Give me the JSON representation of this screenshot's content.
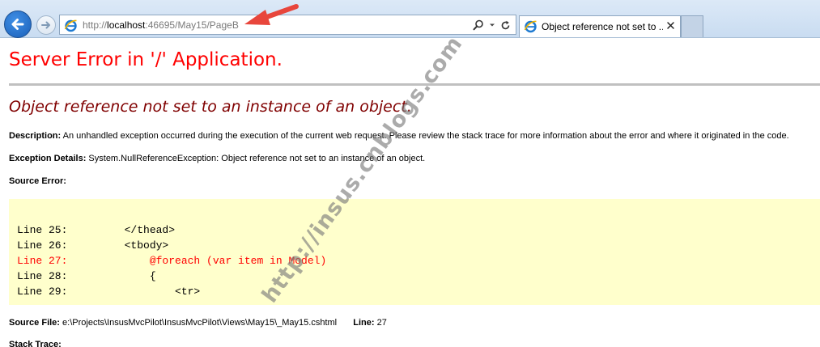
{
  "browser": {
    "url_prefix": "http://",
    "url_host": "localhost",
    "url_rest": ":46695/May15/PageB",
    "tab_title": "Object reference not set to ...",
    "icons": {
      "back": "back-arrow-icon",
      "forward": "forward-arrow-icon",
      "page": "internet-explorer-icon",
      "search": "search-icon",
      "dropdown": "chevron-down-icon",
      "refresh": "refresh-icon",
      "tab_close": "close-icon"
    },
    "colors": {
      "back_button": "#1a5fb8",
      "annotation_arrow": "#e8463c"
    }
  },
  "error": {
    "title": "Server Error in '/' Application.",
    "message": "Object reference not set to an instance of an object.",
    "description_label": "Description:",
    "description_text": "An unhandled exception occurred during the execution of the current web request. Please review the stack trace for more information about the error and where it originated in the code.",
    "exception_label": "Exception Details:",
    "exception_text": "System.NullReferenceException: Object reference not set to an instance of an object.",
    "source_error_label": "Source Error:",
    "source_lines": [
      {
        "text": "Line 25:         </thead>",
        "highlight": false
      },
      {
        "text": "Line 26:         <tbody>",
        "highlight": false
      },
      {
        "text": "Line 27:             @foreach (var item in Model)",
        "highlight": true
      },
      {
        "text": "Line 28:             {",
        "highlight": false
      },
      {
        "text": "Line 29:                 <tr>",
        "highlight": false
      }
    ],
    "source_file_label": "Source File:",
    "source_file_path": "e:\\Projects\\InsusMvcPilot\\InsusMvcPilot\\Views\\May15\\_May15.cshtml",
    "line_label": "Line:",
    "line_number": "27",
    "stack_trace_label": "Stack Trace:",
    "colors": {
      "title": "#ff0000",
      "message": "#800000",
      "code_background": "#ffffcc",
      "code_highlight": "#ff0000"
    }
  },
  "watermark": "http://insus.cnblogs.com"
}
